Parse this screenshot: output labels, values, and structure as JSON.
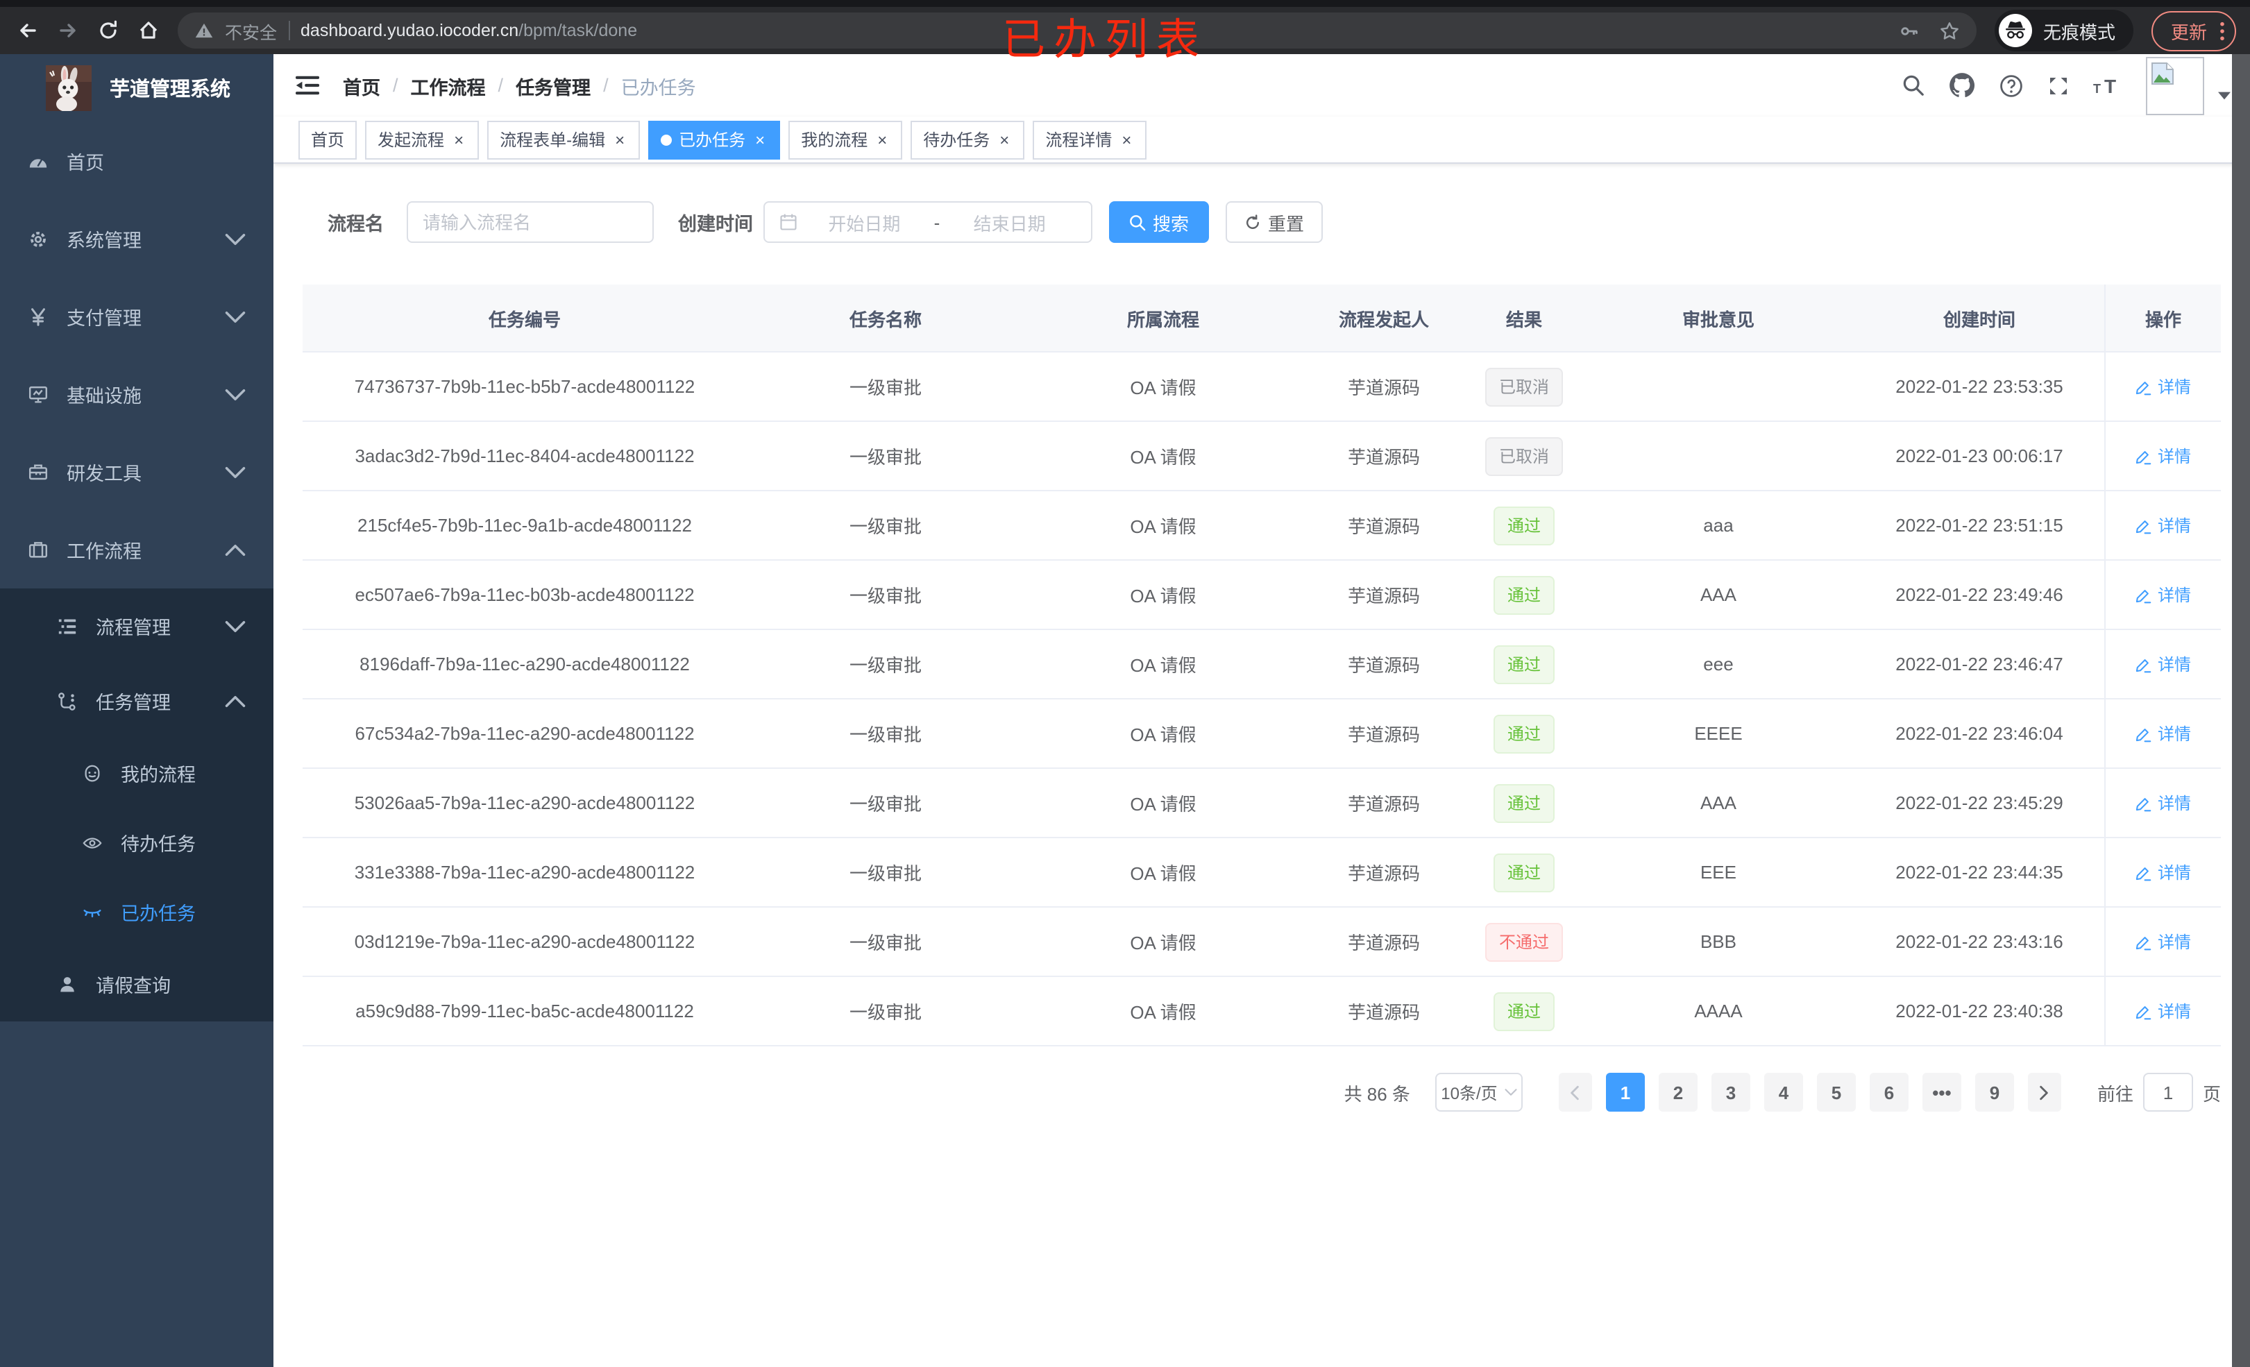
{
  "colors": {
    "accent": "#409eff",
    "success": "#67c23a",
    "danger": "#f56c6c",
    "info": "#909399",
    "sidebar_bg": "#304156",
    "submenu_bg": "#1f2d3d",
    "annotation": "#f5290f",
    "update_pill": "#f28b82"
  },
  "annotation": {
    "text": "已办列表",
    "color": "#f5290f"
  },
  "browser": {
    "security_label": "不安全",
    "url_host": "dashboard.yudao.iocoder.cn",
    "url_path": "/bpm/task/done",
    "incognito_label": "无痕模式",
    "update_label": "更新"
  },
  "sidebar": {
    "logo_title": "芋道管理系统",
    "menu": [
      {
        "label": "首页",
        "icon": "dashboard-icon",
        "level": 1
      },
      {
        "label": "系统管理",
        "icon": "gear-icon",
        "level": 1,
        "arrow": "down"
      },
      {
        "label": "支付管理",
        "icon": "yen-icon",
        "level": 1,
        "arrow": "down"
      },
      {
        "label": "基础设施",
        "icon": "monitor-icon",
        "level": 1,
        "arrow": "down"
      },
      {
        "label": "研发工具",
        "icon": "toolbox-icon",
        "level": 1,
        "arrow": "down"
      },
      {
        "label": "工作流程",
        "icon": "briefcase-icon",
        "level": 1,
        "arrow": "up"
      },
      {
        "label": "流程管理",
        "icon": "tree-icon",
        "level": 2,
        "arrow": "down",
        "dark": true
      },
      {
        "label": "任务管理",
        "icon": "flow-icon",
        "level": 2,
        "arrow": "up",
        "dark": true
      },
      {
        "label": "我的流程",
        "icon": "face-icon",
        "level": 3,
        "dark": true
      },
      {
        "label": "待办任务",
        "icon": "eye-icon",
        "level": 3,
        "dark": true
      },
      {
        "label": "已办任务",
        "icon": "eye-closed-icon",
        "level": 3,
        "dark": true,
        "active": true
      },
      {
        "label": "请假查询",
        "icon": "user-icon",
        "level": 2,
        "dark": true
      }
    ]
  },
  "header": {
    "breadcrumb": [
      {
        "label": "首页",
        "muted": false
      },
      {
        "label": "工作流程",
        "muted": false
      },
      {
        "label": "任务管理",
        "muted": false
      },
      {
        "label": "已办任务",
        "muted": true
      }
    ]
  },
  "tabs": [
    {
      "label": "首页",
      "closable": false,
      "active": false
    },
    {
      "label": "发起流程",
      "closable": true,
      "active": false
    },
    {
      "label": "流程表单-编辑",
      "closable": true,
      "active": false
    },
    {
      "label": "已办任务",
      "closable": true,
      "active": true
    },
    {
      "label": "我的流程",
      "closable": true,
      "active": false
    },
    {
      "label": "待办任务",
      "closable": true,
      "active": false
    },
    {
      "label": "流程详情",
      "closable": true,
      "active": false
    }
  ],
  "filters": {
    "name_label": "流程名",
    "name_placeholder": "请输入流程名",
    "time_label": "创建时间",
    "start_placeholder": "开始日期",
    "range_separator": "-",
    "end_placeholder": "结束日期",
    "search_label": "搜索",
    "reset_label": "重置"
  },
  "table": {
    "columns": [
      "任务编号",
      "任务名称",
      "所属流程",
      "流程发起人",
      "结果",
      "审批意见",
      "创建时间",
      "操作"
    ],
    "detail_label": "详情",
    "rows": [
      {
        "id": "74736737-7b9b-11ec-b5b7-acde48001122",
        "name": "一级审批",
        "process": "OA 请假",
        "starter": "芋道源码",
        "result": "已取消",
        "result_type": "info",
        "comment": "",
        "created": "2022-01-22 23:53:35"
      },
      {
        "id": "3adac3d2-7b9d-11ec-8404-acde48001122",
        "name": "一级审批",
        "process": "OA 请假",
        "starter": "芋道源码",
        "result": "已取消",
        "result_type": "info",
        "comment": "",
        "created": "2022-01-23 00:06:17"
      },
      {
        "id": "215cf4e5-7b9b-11ec-9a1b-acde48001122",
        "name": "一级审批",
        "process": "OA 请假",
        "starter": "芋道源码",
        "result": "通过",
        "result_type": "success",
        "comment": "aaa",
        "created": "2022-01-22 23:51:15"
      },
      {
        "id": "ec507ae6-7b9a-11ec-b03b-acde48001122",
        "name": "一级审批",
        "process": "OA 请假",
        "starter": "芋道源码",
        "result": "通过",
        "result_type": "success",
        "comment": "AAA",
        "created": "2022-01-22 23:49:46"
      },
      {
        "id": "8196daff-7b9a-11ec-a290-acde48001122",
        "name": "一级审批",
        "process": "OA 请假",
        "starter": "芋道源码",
        "result": "通过",
        "result_type": "success",
        "comment": "eee",
        "created": "2022-01-22 23:46:47"
      },
      {
        "id": "67c534a2-7b9a-11ec-a290-acde48001122",
        "name": "一级审批",
        "process": "OA 请假",
        "starter": "芋道源码",
        "result": "通过",
        "result_type": "success",
        "comment": "EEEE",
        "created": "2022-01-22 23:46:04"
      },
      {
        "id": "53026aa5-7b9a-11ec-a290-acde48001122",
        "name": "一级审批",
        "process": "OA 请假",
        "starter": "芋道源码",
        "result": "通过",
        "result_type": "success",
        "comment": "AAA",
        "created": "2022-01-22 23:45:29"
      },
      {
        "id": "331e3388-7b9a-11ec-a290-acde48001122",
        "name": "一级审批",
        "process": "OA 请假",
        "starter": "芋道源码",
        "result": "通过",
        "result_type": "success",
        "comment": "EEE",
        "created": "2022-01-22 23:44:35"
      },
      {
        "id": "03d1219e-7b9a-11ec-a290-acde48001122",
        "name": "一级审批",
        "process": "OA 请假",
        "starter": "芋道源码",
        "result": "不通过",
        "result_type": "danger",
        "comment": "BBB",
        "created": "2022-01-22 23:43:16"
      },
      {
        "id": "a59c9d88-7b99-11ec-ba5c-acde48001122",
        "name": "一级审批",
        "process": "OA 请假",
        "starter": "芋道源码",
        "result": "通过",
        "result_type": "success",
        "comment": "AAAA",
        "created": "2022-01-22 23:40:38"
      }
    ]
  },
  "pagination": {
    "total_label": "共 86 条",
    "page_size": "10条/页",
    "pages": [
      "1",
      "2",
      "3",
      "4",
      "5",
      "6",
      "•••",
      "9"
    ],
    "active_page": "1",
    "goto_label": "前往",
    "goto_value": "1",
    "page_unit": "页"
  }
}
